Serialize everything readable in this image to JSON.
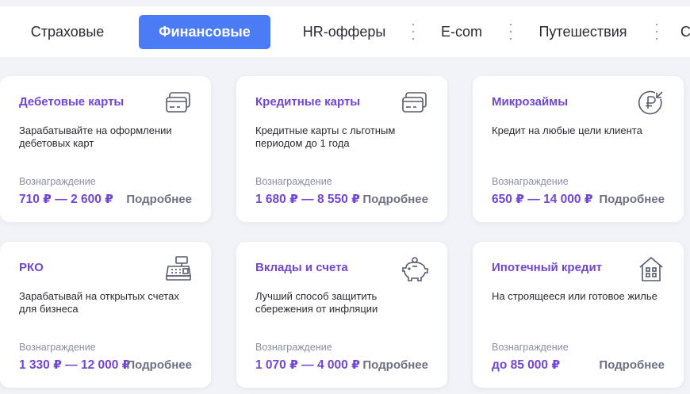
{
  "tabs": [
    {
      "label": "Страховые",
      "active": false
    },
    {
      "label": "Финансовые",
      "active": true
    },
    {
      "label": "HR-офферы",
      "active": false
    },
    {
      "label": "E-com",
      "active": false
    },
    {
      "label": "Путешествия",
      "active": false
    },
    {
      "label": "С",
      "active": false
    }
  ],
  "accent_color": "#4b7cf5",
  "title_color": "#7045d8",
  "reward_label": "Вознаграждение",
  "more_label": "Подробнее",
  "cards": [
    {
      "title": "Дебетовые карты",
      "icon": "debit-card-icon",
      "description": "Зарабатывайте на оформлении дебетовых карт",
      "reward": "710 ₽ — 2 600 ₽"
    },
    {
      "title": "Кредитные карты",
      "icon": "credit-card-icon",
      "description": "Кредитные карты с льготным периодом до 1 года",
      "reward": "1 680 ₽ — 8 550 ₽"
    },
    {
      "title": "Микрозаймы",
      "icon": "ruble-return-icon",
      "description": "Кредит на любые цели клиента",
      "reward": "650 ₽ — 14 000 ₽"
    },
    {
      "title": "РКО",
      "icon": "cash-register-icon",
      "description": "Зарабатывай на открытых счетах для бизнеса",
      "reward": "1 330 ₽ — 12 000 ₽"
    },
    {
      "title": "Вклады и счета",
      "icon": "piggy-bank-icon",
      "description": "Лучший способ защитить сбережения от инфляции",
      "reward": "1 070 ₽ — 4 000 ₽"
    },
    {
      "title": "Ипотечный кредит",
      "icon": "house-icon",
      "description": "На строящееся или готовое жилье",
      "reward": "до 85 000 ₽"
    }
  ]
}
